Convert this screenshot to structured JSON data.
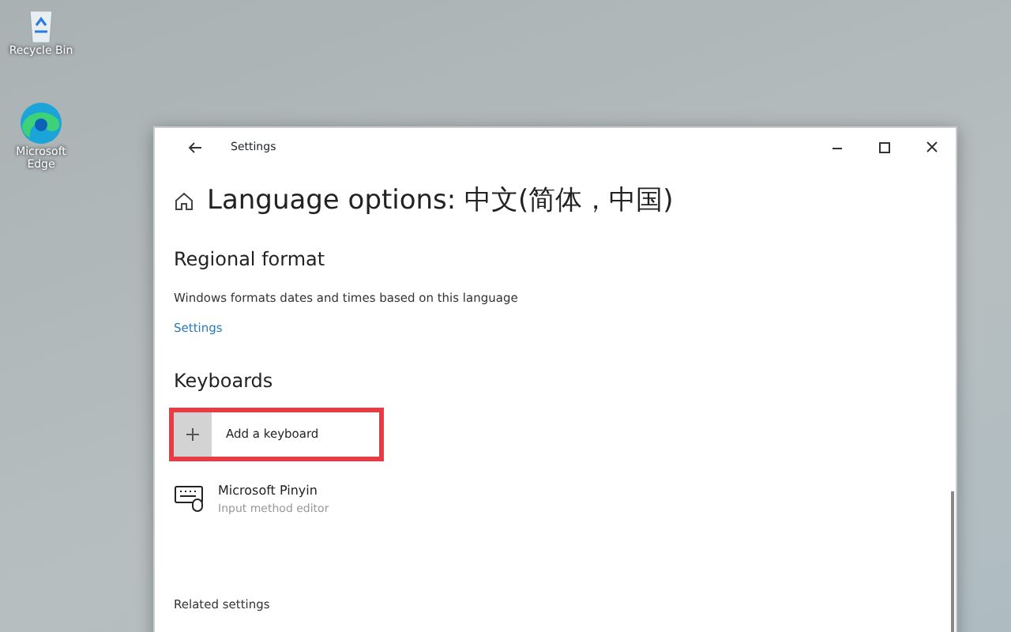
{
  "desktop_icons": [
    {
      "kind": "recycle",
      "label": "Recycle Bin"
    },
    {
      "kind": "edge",
      "label": "Microsoft Edge"
    }
  ],
  "window": {
    "title": "Settings",
    "page_title": "Language options: 中文(简体，中国)"
  },
  "sections": [
    {
      "heading": "Regional format",
      "description": "Windows formats dates and times based on this language",
      "link": "Settings"
    },
    {
      "heading": "Keyboards",
      "add_button": {
        "label": "Add a keyboard",
        "highlighted": true
      },
      "keyboards": [
        {
          "name": "Microsoft Pinyin",
          "subtitle": "Input method editor"
        }
      ]
    }
  ],
  "related_heading": "Related settings"
}
